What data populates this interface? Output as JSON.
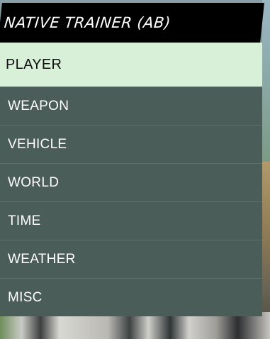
{
  "menu": {
    "title": "NATIVE TRAINER (AB)",
    "items": [
      {
        "label": "PLAYER",
        "selected": true
      },
      {
        "label": "WEAPON",
        "selected": false
      },
      {
        "label": "VEHICLE",
        "selected": false
      },
      {
        "label": "WORLD",
        "selected": false
      },
      {
        "label": "TIME",
        "selected": false
      },
      {
        "label": "WEATHER",
        "selected": false
      },
      {
        "label": "MISC",
        "selected": false
      }
    ]
  },
  "colors": {
    "header_bg": "#000000",
    "selected_bg": "#d8f0d8",
    "item_bg": "#4a5d59",
    "item_text": "#ffffff"
  }
}
